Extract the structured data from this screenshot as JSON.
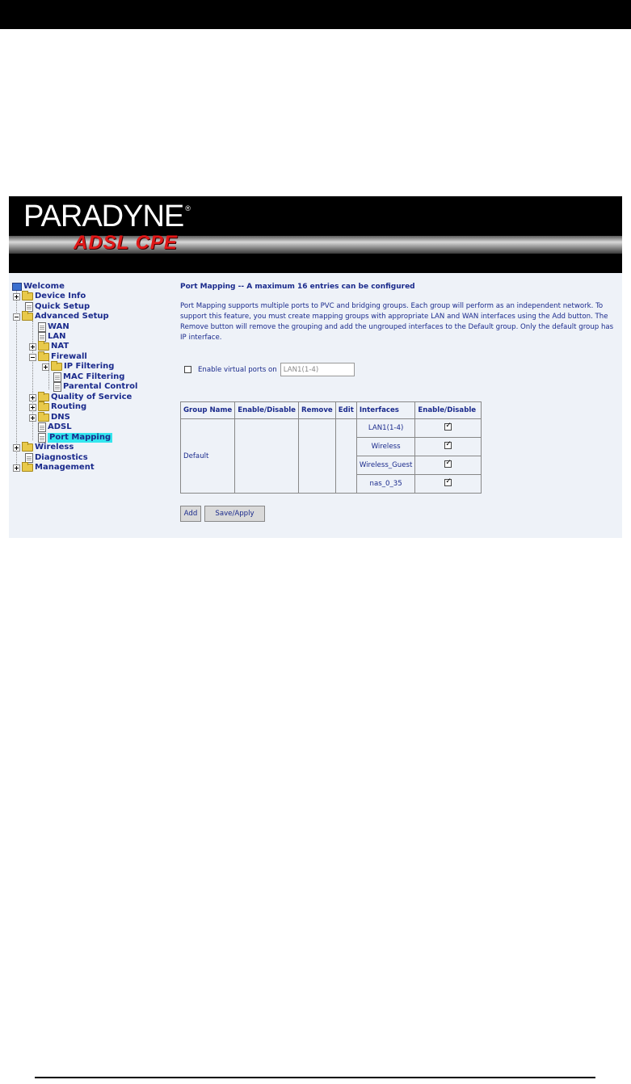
{
  "banner": {
    "logo": "PARADYNE",
    "logo_reg": "®",
    "subtitle": "ADSL CPE"
  },
  "sidebar": {
    "items": [
      {
        "label": "Welcome",
        "icon": "monitor-icon"
      },
      {
        "label": "Device Info",
        "icon": "folder-icon"
      },
      {
        "label": "Quick Setup",
        "icon": "page-icon"
      },
      {
        "label": "Advanced Setup",
        "icon": "folder-icon"
      },
      {
        "label": "WAN",
        "icon": "page-icon"
      },
      {
        "label": "LAN",
        "icon": "page-icon"
      },
      {
        "label": "NAT",
        "icon": "folder-icon"
      },
      {
        "label": "Firewall",
        "icon": "folder-icon"
      },
      {
        "label": "IP Filtering",
        "icon": "folder-icon"
      },
      {
        "label": "MAC Filtering",
        "icon": "page-icon"
      },
      {
        "label": "Parental Control",
        "icon": "page-icon"
      },
      {
        "label": "Quality of Service",
        "icon": "folder-icon"
      },
      {
        "label": "Routing",
        "icon": "folder-icon"
      },
      {
        "label": "DNS",
        "icon": "folder-icon"
      },
      {
        "label": "ADSL",
        "icon": "page-icon"
      },
      {
        "label": "Port Mapping",
        "icon": "page-icon"
      },
      {
        "label": "Wireless",
        "icon": "folder-icon"
      },
      {
        "label": "Diagnostics",
        "icon": "page-icon"
      },
      {
        "label": "Management",
        "icon": "folder-icon"
      }
    ],
    "active": "Port Mapping"
  },
  "main": {
    "title": "Port Mapping -- A maximum 16 entries can be configured",
    "description": "Port Mapping supports multiple ports to PVC and bridging groups. Each group will perform as an independent network. To support this feature, you must create mapping groups with appropriate LAN and WAN interfaces using the Add button. The Remove button will remove the grouping and add the ungrouped interfaces to the Default group. Only the default group has IP interface.",
    "virtual_ports": {
      "label": "Enable virtual ports on",
      "value": "LAN1(1-4)",
      "checked": false
    },
    "table": {
      "headers": [
        "Group Name",
        "Enable/Disable",
        "Remove",
        "Edit",
        "Interfaces",
        "Enable/Disable"
      ],
      "group_name": "Default",
      "interfaces": [
        {
          "name": "LAN1(1-4)",
          "enabled": true
        },
        {
          "name": "Wireless",
          "enabled": true
        },
        {
          "name": "Wireless_Guest",
          "enabled": true
        },
        {
          "name": "nas_0_35",
          "enabled": true
        }
      ]
    },
    "buttons": {
      "add": "Add",
      "save_apply": "Save/Apply"
    }
  }
}
